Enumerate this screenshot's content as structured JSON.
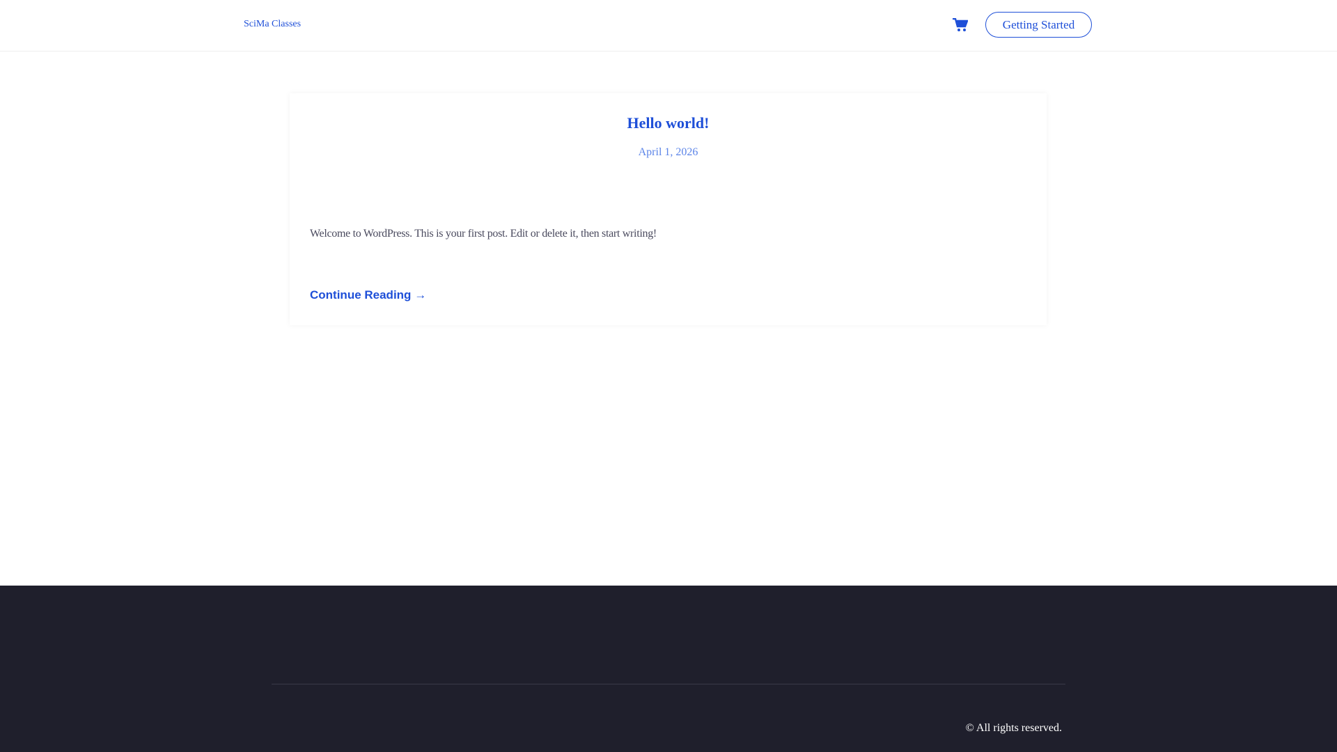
{
  "header": {
    "site_title": "SciMa Classes",
    "cart_icon": "shopping-cart-icon",
    "cta_label": "Getting Started"
  },
  "post": {
    "title": "Hello world!",
    "date": "April 1, 2026",
    "excerpt": "Welcome to WordPress. This is your first post. Edit or delete it, then start writing!",
    "continue_label": "Continue Reading",
    "continue_icon": "arrow-right-icon"
  },
  "footer": {
    "copyright": "© All rights reserved."
  },
  "colors": {
    "accent": "#1e4fd8",
    "footer_bg": "#1f1f2c"
  }
}
